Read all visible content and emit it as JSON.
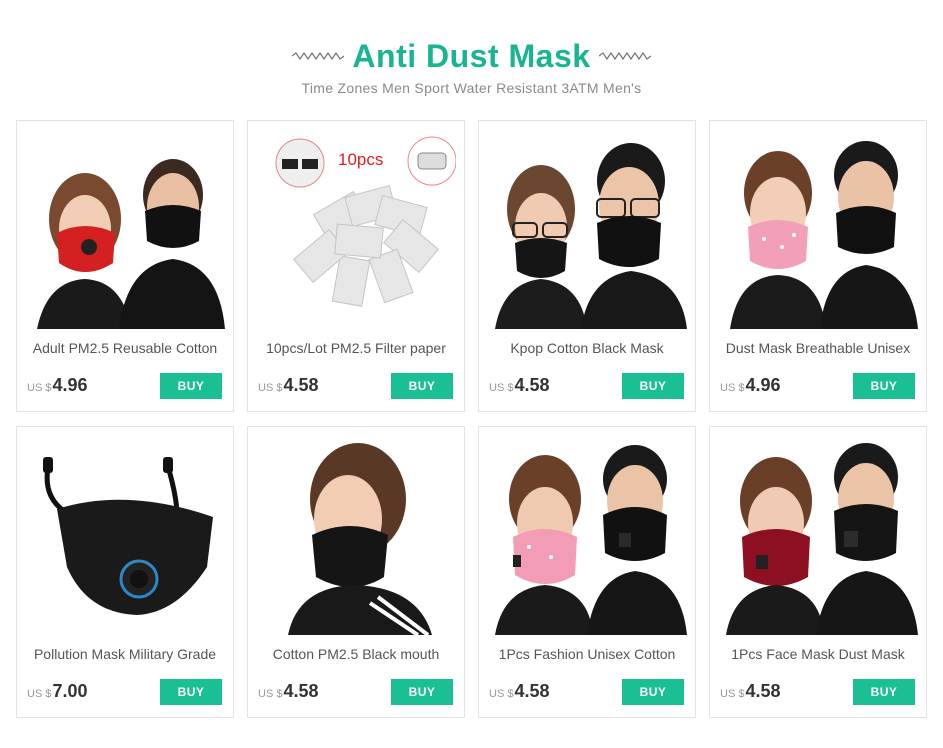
{
  "header": {
    "title": "Anti Dust Mask",
    "subtitle": "Time Zones Men Sport Water Resistant 3ATM Men's"
  },
  "colors": {
    "accent": "#19b590",
    "buy_button": "#1bbf94"
  },
  "products": [
    {
      "name": "Adult PM2.5 Reusable Cotton",
      "currency": "US $",
      "price": "4.96",
      "buy_label": "BUY",
      "image": "man-woman-black-mask-red-valve-mask"
    },
    {
      "name": "10pcs/Lot PM2.5 Filter paper",
      "currency": "US $",
      "price": "4.58",
      "buy_label": "BUY",
      "image": "filter-papers",
      "badge": "10pcs"
    },
    {
      "name": "Kpop Cotton Black Mask",
      "currency": "US $",
      "price": "4.58",
      "buy_label": "BUY",
      "image": "couple-black-masks-glasses"
    },
    {
      "name": "Dust Mask Breathable Unisex",
      "currency": "US $",
      "price": "4.96",
      "buy_label": "BUY",
      "image": "couple-pink-black-masks"
    },
    {
      "name": "Pollution Mask Military Grade",
      "currency": "US $",
      "price": "7.00",
      "buy_label": "BUY",
      "image": "black-mask-blue-valve"
    },
    {
      "name": "Cotton PM2.5 Black mouth",
      "currency": "US $",
      "price": "4.58",
      "buy_label": "BUY",
      "image": "woman-black-mask"
    },
    {
      "name": "1Pcs Fashion Unisex Cotton",
      "currency": "US $",
      "price": "4.58",
      "buy_label": "BUY",
      "image": "couple-pink-black-valve-masks"
    },
    {
      "name": "1Pcs Face Mask Dust Mask",
      "currency": "US $",
      "price": "4.58",
      "buy_label": "BUY",
      "image": "couple-red-black-valve-masks"
    }
  ]
}
